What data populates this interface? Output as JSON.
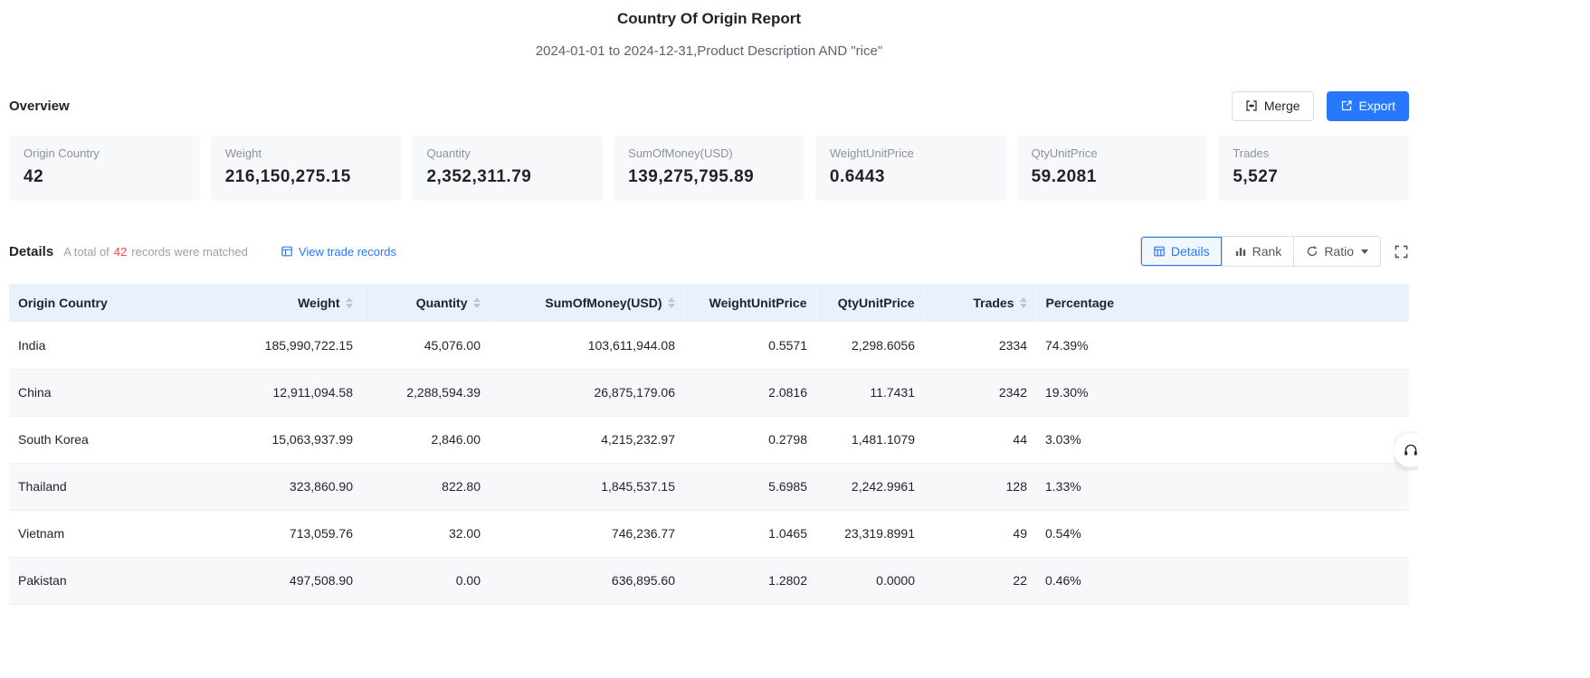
{
  "page": {
    "title": "Country Of Origin Report",
    "subtitle": "2024-01-01 to 2024-12-31,Product Description AND \"rice\""
  },
  "overview": {
    "heading": "Overview",
    "merge_label": "Merge",
    "export_label": "Export",
    "stats": [
      {
        "label": "Origin Country",
        "value": "42"
      },
      {
        "label": "Weight",
        "value": "216,150,275.15"
      },
      {
        "label": "Quantity",
        "value": "2,352,311.79"
      },
      {
        "label": "SumOfMoney(USD)",
        "value": "139,275,795.89"
      },
      {
        "label": "WeightUnitPrice",
        "value": "0.6443"
      },
      {
        "label": "QtyUnitPrice",
        "value": "59.2081"
      },
      {
        "label": "Trades",
        "value": "5,527"
      }
    ]
  },
  "details": {
    "heading": "Details",
    "match_prefix": "A total of",
    "match_count": "42",
    "match_suffix": "records were matched",
    "view_trade_records": "View trade records",
    "tabs": {
      "details": "Details",
      "rank": "Rank",
      "ratio": "Ratio"
    }
  },
  "table": {
    "columns": [
      {
        "key": "country",
        "label": "Origin Country",
        "align": "left",
        "sortable": false
      },
      {
        "key": "weight",
        "label": "Weight",
        "align": "right",
        "sortable": true
      },
      {
        "key": "quantity",
        "label": "Quantity",
        "align": "right",
        "sortable": true
      },
      {
        "key": "sum_of_money_usd",
        "label": "SumOfMoney(USD)",
        "align": "right",
        "sortable": true
      },
      {
        "key": "weight_unit_price",
        "label": "WeightUnitPrice",
        "align": "right",
        "sortable": false
      },
      {
        "key": "qty_unit_price",
        "label": "QtyUnitPrice",
        "align": "right",
        "sortable": false
      },
      {
        "key": "trades",
        "label": "Trades",
        "align": "right",
        "sortable": true
      },
      {
        "key": "percentage",
        "label": "Percentage",
        "align": "left",
        "sortable": false
      }
    ],
    "rows": [
      {
        "country": "India",
        "weight": "185,990,722.15",
        "quantity": "45,076.00",
        "sum_of_money_usd": "103,611,944.08",
        "weight_unit_price": "0.5571",
        "qty_unit_price": "2,298.6056",
        "trades": "2334",
        "percentage": "74.39%"
      },
      {
        "country": "China",
        "weight": "12,911,094.58",
        "quantity": "2,288,594.39",
        "sum_of_money_usd": "26,875,179.06",
        "weight_unit_price": "2.0816",
        "qty_unit_price": "11.7431",
        "trades": "2342",
        "percentage": "19.30%"
      },
      {
        "country": "South Korea",
        "weight": "15,063,937.99",
        "quantity": "2,846.00",
        "sum_of_money_usd": "4,215,232.97",
        "weight_unit_price": "0.2798",
        "qty_unit_price": "1,481.1079",
        "trades": "44",
        "percentage": "3.03%"
      },
      {
        "country": "Thailand",
        "weight": "323,860.90",
        "quantity": "822.80",
        "sum_of_money_usd": "1,845,537.15",
        "weight_unit_price": "5.6985",
        "qty_unit_price": "2,242.9961",
        "trades": "128",
        "percentage": "1.33%"
      },
      {
        "country": "Vietnam",
        "weight": "713,059.76",
        "quantity": "32.00",
        "sum_of_money_usd": "746,236.77",
        "weight_unit_price": "1.0465",
        "qty_unit_price": "23,319.8991",
        "trades": "49",
        "percentage": "0.54%"
      },
      {
        "country": "Pakistan",
        "weight": "497,508.90",
        "quantity": "0.00",
        "sum_of_money_usd": "636,895.60",
        "weight_unit_price": "1.2802",
        "qty_unit_price": "0.0000",
        "trades": "22",
        "percentage": "0.46%"
      }
    ]
  },
  "colors": {
    "accent_blue": "#2878ff",
    "count_red": "#f54a45",
    "table_header_bg": "#e8f1fc",
    "card_bg": "#f7f8fa"
  }
}
